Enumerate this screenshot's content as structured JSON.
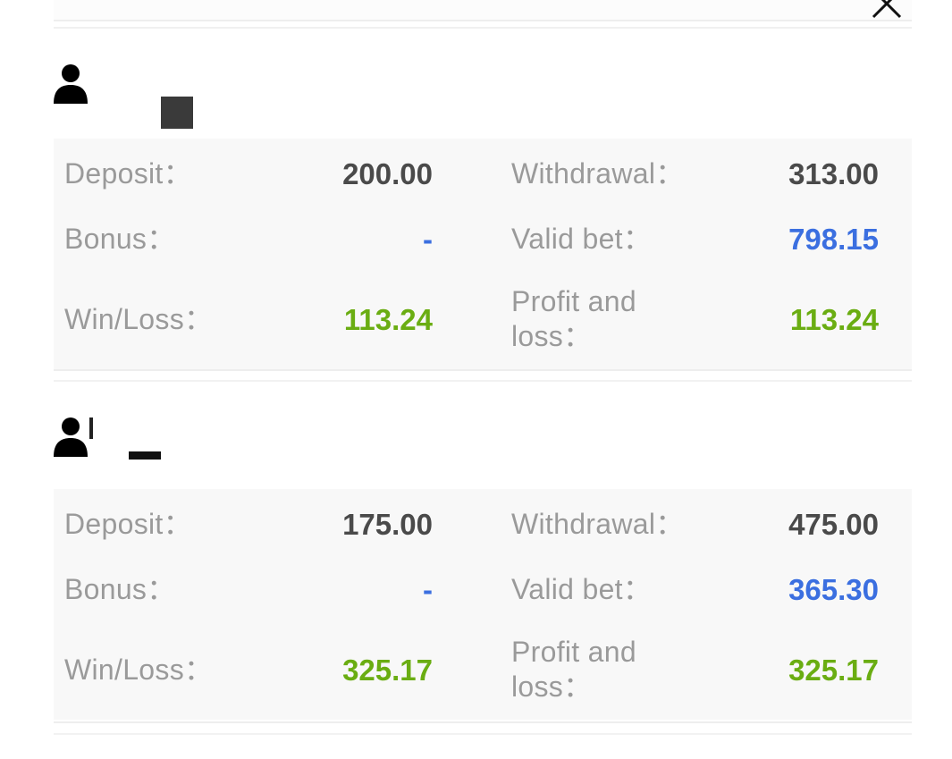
{
  "header": {
    "close_icon": "close-icon"
  },
  "accounts": [
    {
      "user_icon": "user-icon",
      "username": "",
      "deposit_label": "Deposit：",
      "deposit_value": "200.00",
      "withdrawal_label": "Withdrawal：",
      "withdrawal_value": "313.00",
      "bonus_label": "Bonus：",
      "bonus_value": "-",
      "valid_bet_label": "Valid bet：",
      "valid_bet_value": "798.15",
      "winloss_label": "Win/Loss：",
      "winloss_value": "113.24",
      "pnl_label_line1": "Profit and",
      "pnl_label_line2": "loss：",
      "pnl_value": "113.24"
    },
    {
      "user_icon": "user-icon",
      "username": "",
      "deposit_label": "Deposit：",
      "deposit_value": "175.00",
      "withdrawal_label": "Withdrawal：",
      "withdrawal_value": "475.00",
      "bonus_label": "Bonus：",
      "bonus_value": "-",
      "valid_bet_label": "Valid bet：",
      "valid_bet_value": "365.30",
      "winloss_label": "Win/Loss：",
      "winloss_value": "325.17",
      "pnl_label_line1": "Profit and",
      "pnl_label_line2": "loss：",
      "pnl_value": "325.17"
    }
  ],
  "colors": {
    "label": "#9a9a9a",
    "value_dark": "#4a4a4a",
    "value_blue": "#3b6fe0",
    "value_green": "#6aad12",
    "panel_bg": "#f8f8f8"
  }
}
